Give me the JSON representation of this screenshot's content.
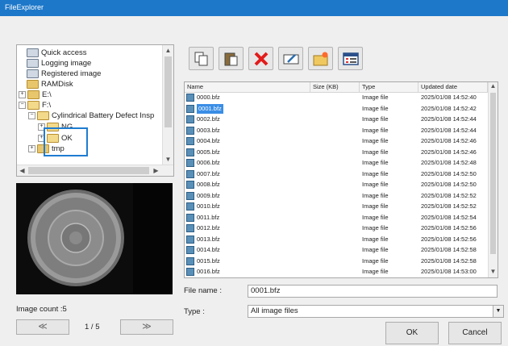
{
  "window": {
    "title": "FileExplorer"
  },
  "tree": {
    "items": [
      {
        "label": "Quick access",
        "expander": ""
      },
      {
        "label": "Logging image",
        "expander": ""
      },
      {
        "label": "Registered image",
        "expander": ""
      },
      {
        "label": "RAMDisk",
        "expander": ""
      },
      {
        "label": "E:\\",
        "expander": "+"
      },
      {
        "label": "F:\\",
        "expander": "−"
      },
      {
        "label": "Cylindrical Battery Defect Insp",
        "expander": "−"
      },
      {
        "label": "NG",
        "expander": "+"
      },
      {
        "label": "OK",
        "expander": "+"
      },
      {
        "label": "tmp",
        "expander": "+"
      }
    ]
  },
  "preview": {
    "image_count_label": "Image count :5",
    "page_label": "1 / 5",
    "prev_label": "≪",
    "next_label": "≫"
  },
  "toolbar": {
    "icons": [
      "copy-icon",
      "paste-icon",
      "delete-icon",
      "rename-icon",
      "new-folder-icon",
      "view-icon"
    ]
  },
  "list": {
    "columns": [
      "Name",
      "Size (KB)",
      "Type",
      "Updated date"
    ],
    "rows": [
      {
        "name": "0000.bfz",
        "type": "Image file",
        "date": "2025/01/08 14:52:40"
      },
      {
        "name": "0001.bfz",
        "type": "Image file",
        "date": "2025/01/08 14:52:42"
      },
      {
        "name": "0002.bfz",
        "type": "Image file",
        "date": "2025/01/08 14:52:44"
      },
      {
        "name": "0003.bfz",
        "type": "Image file",
        "date": "2025/01/08 14:52:44"
      },
      {
        "name": "0004.bfz",
        "type": "Image file",
        "date": "2025/01/08 14:52:46"
      },
      {
        "name": "0005.bfz",
        "type": "Image file",
        "date": "2025/01/08 14:52:46"
      },
      {
        "name": "0006.bfz",
        "type": "Image file",
        "date": "2025/01/08 14:52:48"
      },
      {
        "name": "0007.bfz",
        "type": "Image file",
        "date": "2025/01/08 14:52:50"
      },
      {
        "name": "0008.bfz",
        "type": "Image file",
        "date": "2025/01/08 14:52:50"
      },
      {
        "name": "0009.bfz",
        "type": "Image file",
        "date": "2025/01/08 14:52:52"
      },
      {
        "name": "0010.bfz",
        "type": "Image file",
        "date": "2025/01/08 14:52:52"
      },
      {
        "name": "0011.bfz",
        "type": "Image file",
        "date": "2025/01/08 14:52:54"
      },
      {
        "name": "0012.bfz",
        "type": "Image file",
        "date": "2025/01/08 14:52:56"
      },
      {
        "name": "0013.bfz",
        "type": "Image file",
        "date": "2025/01/08 14:52:56"
      },
      {
        "name": "0014.bfz",
        "type": "Image file",
        "date": "2025/01/08 14:52:58"
      },
      {
        "name": "0015.bfz",
        "type": "Image file",
        "date": "2025/01/08 14:52:58"
      },
      {
        "name": "0016.bfz",
        "type": "Image file",
        "date": "2025/01/08 14:53:00"
      }
    ]
  },
  "file_name": {
    "label": "File name :",
    "value": "0001.bfz"
  },
  "file_type": {
    "label": "Type :",
    "value": "All image files"
  },
  "buttons": {
    "ok": "OK",
    "cancel": "Cancel"
  }
}
